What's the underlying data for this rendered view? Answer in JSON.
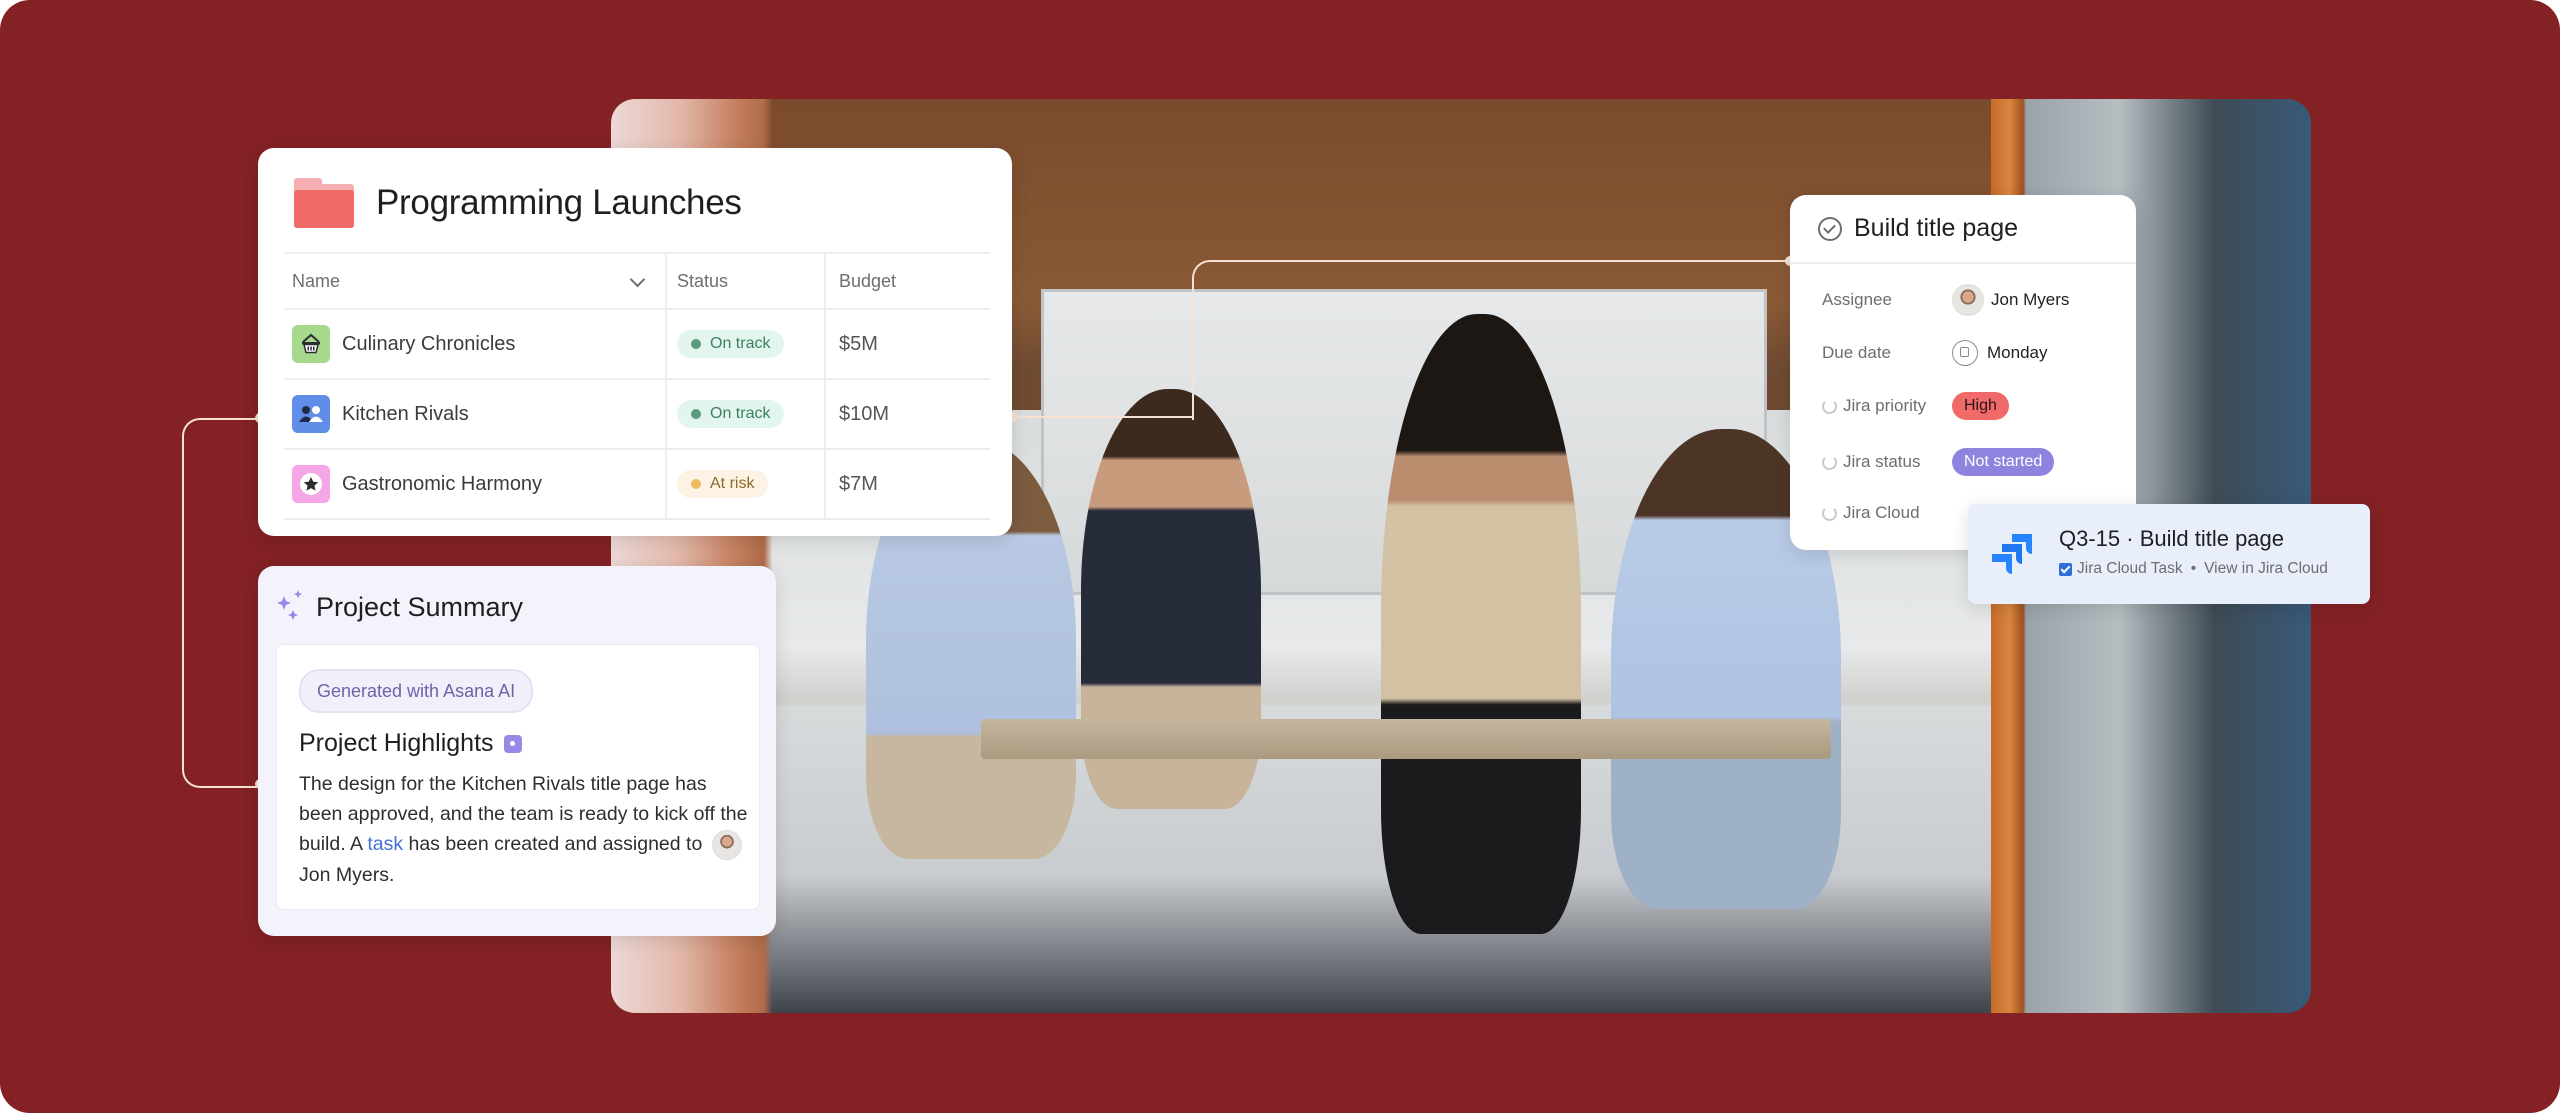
{
  "colors": {
    "background": "#832124",
    "connector": "#f6e2d3",
    "on_track_bg": "#e3f6ee",
    "on_track_text": "#3e7e64",
    "at_risk_bg": "#fdf2e3",
    "at_risk_text": "#8d6a2c",
    "priority_high": "#f06a6a",
    "status_not_started": "#8e84e0",
    "link": "#4573d2",
    "ai_accent": "#9b87e6"
  },
  "launches": {
    "title": "Programming Launches",
    "icon": "folder-icon",
    "columns": [
      "Name",
      "Status",
      "Budget"
    ],
    "rows": [
      {
        "name": "Culinary Chronicles",
        "icon": "basket-icon",
        "status": "On track",
        "status_kind": "on-track",
        "budget": "$5M"
      },
      {
        "name": "Kitchen Rivals",
        "icon": "people-icon",
        "status": "On track",
        "status_kind": "on-track",
        "budget": "$10M"
      },
      {
        "name": "Gastronomic Harmony",
        "icon": "star-icon",
        "status": "At risk",
        "status_kind": "at-risk",
        "budget": "$7M"
      }
    ]
  },
  "summary": {
    "title": "Project Summary",
    "icon": "sparkle-icon",
    "badge": "Generated with Asana AI",
    "highlights_title": "Project Highlights",
    "body_before_link": "The design for the Kitchen Rivals title page has been approved, and the team is ready to kick off the build. A ",
    "link_text": "task",
    "body_after_link": " has been created and assigned to",
    "assignee": "Jon Myers."
  },
  "task": {
    "title": "Build title page",
    "fields": [
      {
        "label": "Assignee",
        "value": "Jon Myers"
      },
      {
        "label": "Due date",
        "value": "Monday"
      },
      {
        "label": "Jira priority",
        "value": "High"
      },
      {
        "label": "Jira status",
        "value": "Not started"
      },
      {
        "label": "Jira Cloud",
        "value": ""
      }
    ]
  },
  "jira": {
    "title": "Q3-15 · Build title page",
    "type": "Jira Cloud Task",
    "separator": "•",
    "link": "View in Jira Cloud"
  }
}
